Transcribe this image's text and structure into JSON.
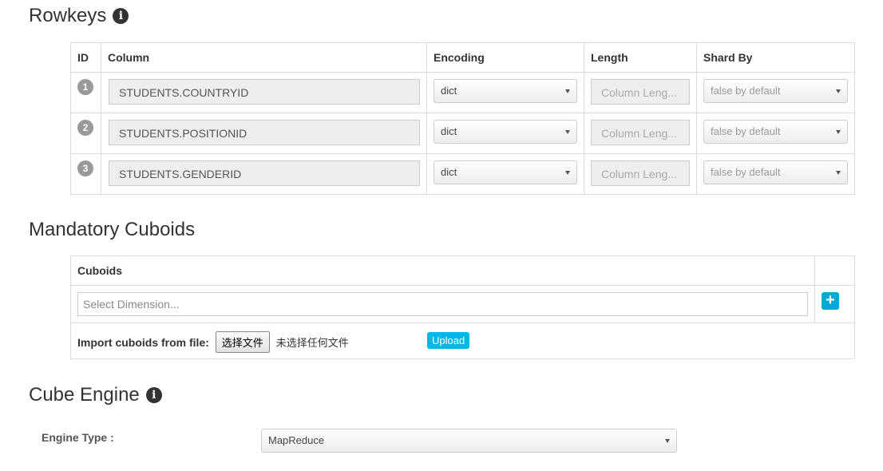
{
  "rowkeys": {
    "title": "Rowkeys",
    "headers": {
      "id": "ID",
      "column": "Column",
      "encoding": "Encoding",
      "length": "Length",
      "shard_by": "Shard By"
    },
    "rows": [
      {
        "id": "1",
        "column": "STUDENTS.COUNTRYID",
        "encoding": "dict",
        "length_placeholder": "Column Leng...",
        "shard_by": "false by default"
      },
      {
        "id": "2",
        "column": "STUDENTS.POSITIONID",
        "encoding": "dict",
        "length_placeholder": "Column Leng...",
        "shard_by": "false by default"
      },
      {
        "id": "3",
        "column": "STUDENTS.GENDERID",
        "encoding": "dict",
        "length_placeholder": "Column Leng...",
        "shard_by": "false by default"
      }
    ]
  },
  "mandatory_cuboids": {
    "title": "Mandatory Cuboids",
    "header": "Cuboids",
    "dimension_placeholder": "Select Dimension...",
    "add_label": "+",
    "import_label": "Import cuboids from file:",
    "choose_file_label": "选择文件",
    "file_status": "未选择任何文件",
    "upload_label": "Upload"
  },
  "cube_engine": {
    "title": "Cube Engine",
    "engine_type_label": "Engine Type :",
    "engine_type_value": "MapReduce"
  },
  "colors": {
    "accent": "#00b7eb",
    "badge": "#999999",
    "border": "#dddddd"
  },
  "icons": {
    "info": "info-circle-icon",
    "caret": "caret-down-icon",
    "add": "plus-icon"
  }
}
